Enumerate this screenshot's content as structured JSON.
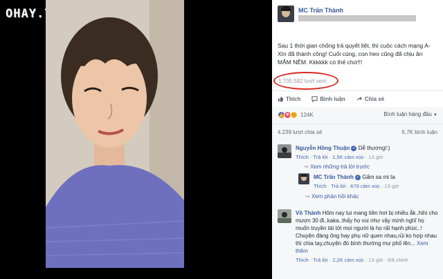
{
  "watermark": "OHAY.TV",
  "post": {
    "author": "MC Trấn Thành",
    "text": "Sau 1 thời gian chống trả quyết liệt, thì cuộc cách mạng A-Xìn đã thành công! Cuối cùng, con heo cũng đã chịu ăn MẮM NÊM. Kkkkkk có thế chứ!!!",
    "views": "1.705.582 lượt xem"
  },
  "actions": {
    "like": "Thích",
    "comment": "Bình luận",
    "share": "Chia sẻ"
  },
  "reactions": {
    "count": "124K"
  },
  "sort_label": "Bình luận hàng đầu",
  "stats": {
    "shares": "4.239 lượt chia sẻ",
    "comments": "6,7K bình luận"
  },
  "comments": [
    {
      "name": "Nguyễn Hồng Thuận",
      "text": "Dễ thương!:)",
      "like": "Thích",
      "reply": "Trả lời",
      "reactions": "1,5K cảm xúc",
      "time": "13 giờ",
      "more_replies": "Xem những trả lời trước"
    },
    {
      "name": "MC Trấn Thành",
      "text": "Gấm sa mi ta",
      "like": "Thích",
      "reply": "Trả lời",
      "reactions": "679 cảm xúc",
      "time": "13 giờ",
      "more_replies": "Xem phản hồi khác"
    },
    {
      "name": "Võ Thành",
      "text": "Hôm nay tui mang tiền hơi bị nhiều ắk..hihi cho mượn 30 đi..kaka..thấy họ vui như vậy mình nghĩ họ muốn truyền tải tới mọi người là họ rất hạnh phúc..!",
      "text2": "Chuyện đàng ông hay phụ nữ quen nhau,rủi ko hợp nhau thì chia tay,chuyện đó bình thường mư phố lên...",
      "see_more": "Xem thêm",
      "like": "Thích",
      "reply": "Trả lời",
      "reactions": "2,2K cảm xúc",
      "time": "13 giờ",
      "edited": "Đã chỉnh"
    }
  ],
  "colors": {
    "link": "#365899",
    "accent": "#4267b2",
    "highlight_oval": "#d9281f"
  }
}
